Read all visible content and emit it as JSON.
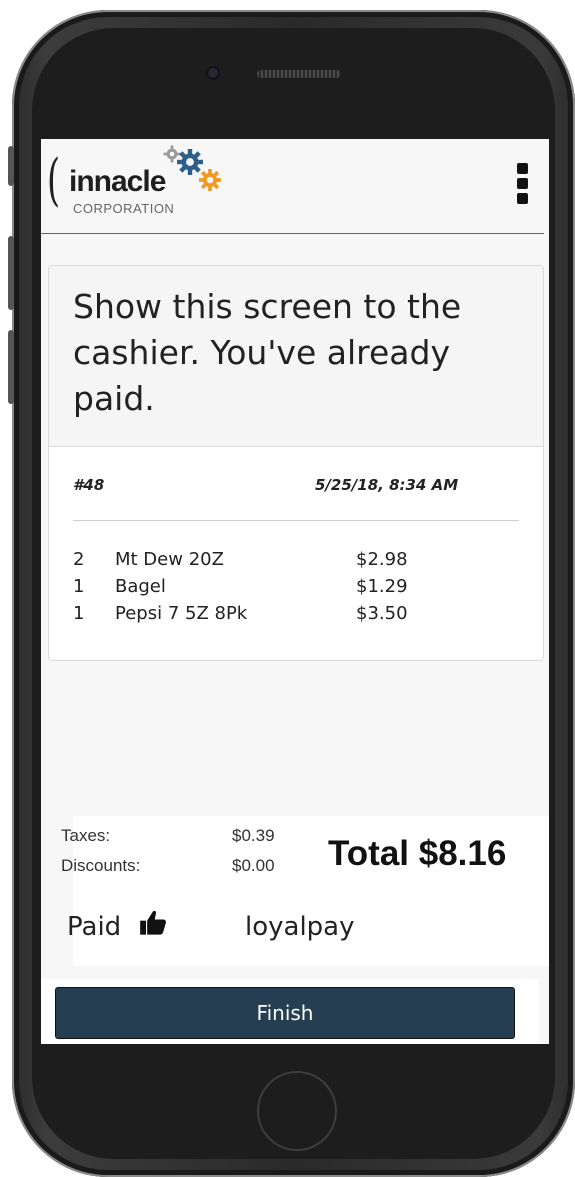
{
  "brand": {
    "logo_name": "Pinnacle",
    "logo_paren": "(",
    "logo_word": "innacle",
    "logo_sub": "CORPORATION"
  },
  "menu_icon": "kebab-menu-icon",
  "receipt": {
    "message": "Show this screen to the cashier. You've already paid.",
    "order_number": "#48",
    "datetime": "5/25/18, 8:34 AM",
    "items": [
      {
        "qty": "2",
        "name": "Mt Dew 20Z",
        "price": "$2.98"
      },
      {
        "qty": "1",
        "name": "Bagel",
        "price": "$1.29"
      },
      {
        "qty": "1",
        "name": "Pepsi 7 5Z 8Pk",
        "price": "$3.50"
      }
    ]
  },
  "summary": {
    "taxes_label": "Taxes:",
    "taxes_value": "$0.39",
    "discounts_label": "Discounts:",
    "discounts_value": "$0.00",
    "total": "Total $8.16",
    "paid_label": "Paid",
    "paid_icon": "thumbs-up-icon",
    "payment_method": "loyalpay"
  },
  "finish_label": "Finish",
  "colors": {
    "button_bg": "#253e52",
    "gear_blue": "#2d5f8a",
    "gear_orange": "#f29a1f",
    "gear_grey": "#9a9a9a"
  }
}
